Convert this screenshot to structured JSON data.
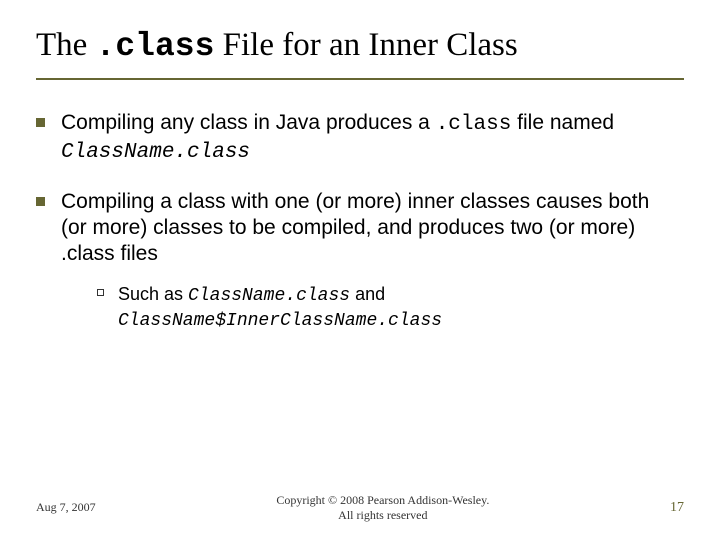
{
  "title": {
    "pre": "The ",
    "code": ".class",
    "post": " File for an Inner Class"
  },
  "bullets": [
    {
      "segments": [
        {
          "t": "Compiling any class in Java produces a ",
          "mono": false,
          "italic": false
        },
        {
          "t": ".class",
          "mono": true,
          "italic": false
        },
        {
          "t": " file named ",
          "mono": false,
          "italic": false
        },
        {
          "t": "ClassName.class",
          "mono": true,
          "italic": true
        }
      ]
    },
    {
      "segments": [
        {
          "t": "Compiling a class with one (or more) inner classes causes both (or more) classes to be compiled, and produces two (or more) .class files",
          "mono": false,
          "italic": false
        }
      ],
      "sub": [
        {
          "segments": [
            {
              "t": "Such as ",
              "mono": false,
              "italic": false
            },
            {
              "t": "ClassName.class",
              "mono": true,
              "italic": true
            },
            {
              "t": " and ",
              "mono": false,
              "italic": false
            },
            {
              "t": "ClassName$InnerClassName.class",
              "mono": true,
              "italic": true
            }
          ]
        }
      ]
    }
  ],
  "footer": {
    "date": "Aug 7, 2007",
    "copyright_line1": "Copyright © 2008 Pearson Addison-Wesley.",
    "copyright_line2": "All rights reserved",
    "page": "17"
  }
}
